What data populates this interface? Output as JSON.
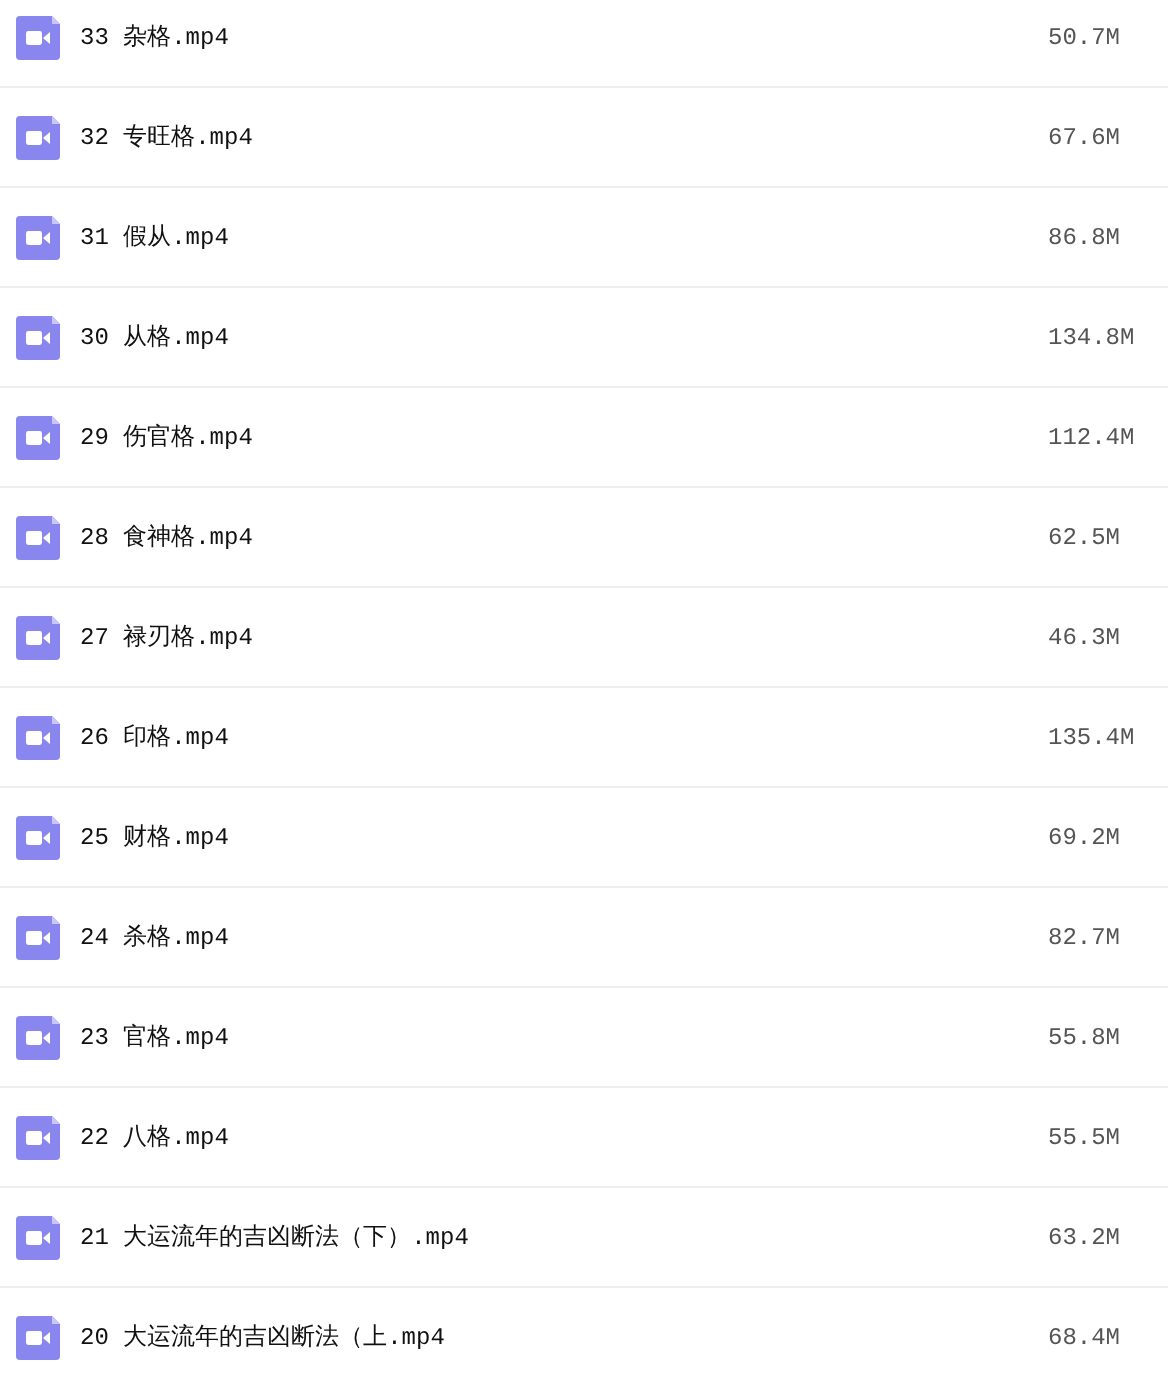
{
  "files": [
    {
      "name": "33 杂格.mp4",
      "size": "50.7M"
    },
    {
      "name": "32 专旺格.mp4",
      "size": "67.6M"
    },
    {
      "name": "31 假从.mp4",
      "size": "86.8M"
    },
    {
      "name": "30 从格.mp4",
      "size": "134.8M"
    },
    {
      "name": "29 伤官格.mp4",
      "size": "112.4M"
    },
    {
      "name": "28 食神格.mp4",
      "size": "62.5M"
    },
    {
      "name": "27 禄刃格.mp4",
      "size": "46.3M"
    },
    {
      "name": "26 印格.mp4",
      "size": "135.4M"
    },
    {
      "name": "25 财格.mp4",
      "size": "69.2M"
    },
    {
      "name": "24 杀格.mp4",
      "size": "82.7M"
    },
    {
      "name": "23 官格.mp4",
      "size": "55.8M"
    },
    {
      "name": "22 八格.mp4",
      "size": "55.5M"
    },
    {
      "name": "21 大运流年的吉凶断法（下）.mp4",
      "size": "63.2M"
    },
    {
      "name": "20 大运流年的吉凶断法（上.mp4",
      "size": "68.4M"
    }
  ]
}
